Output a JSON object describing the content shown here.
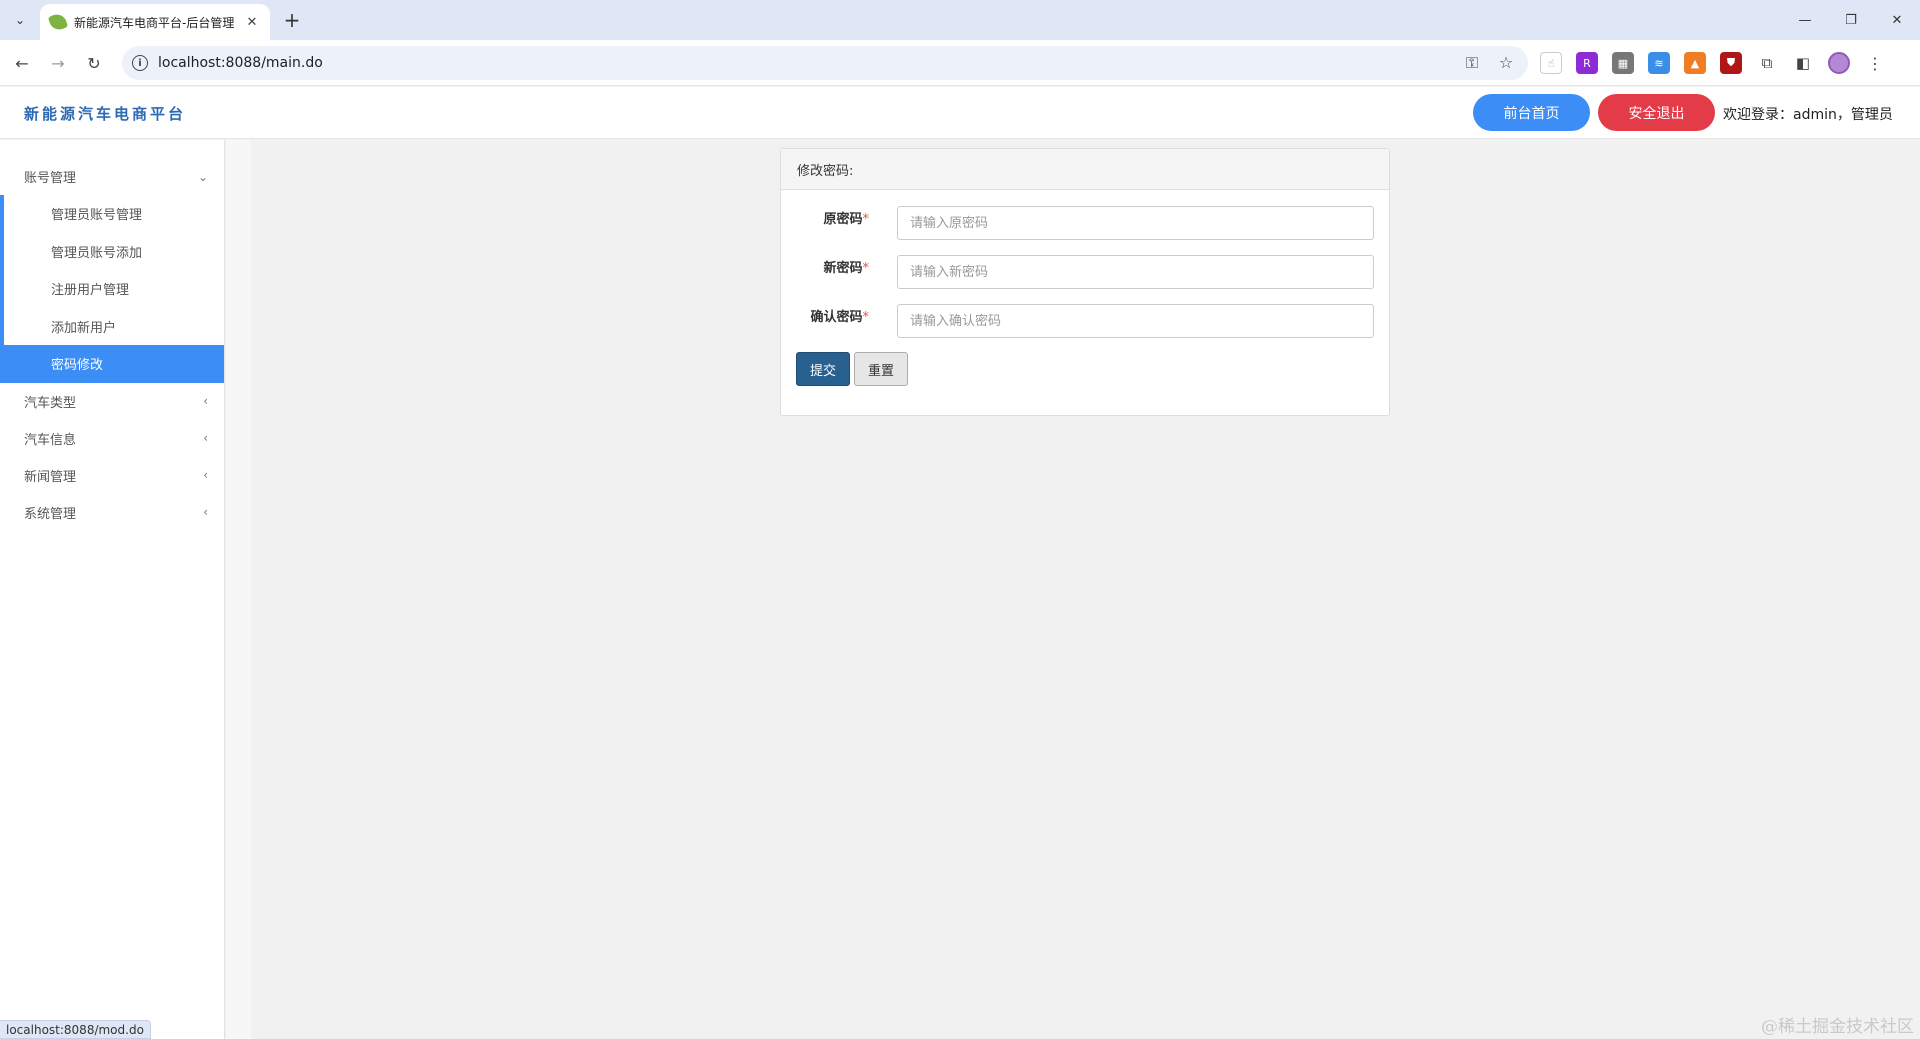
{
  "browser": {
    "tab_title": "新能源汽车电商平台-后台管理",
    "url": "localhost:8088/main.do",
    "status_url": "localhost:8088/mod.do"
  },
  "header": {
    "brand": "新能源汽车电商平台",
    "home_button": "前台首页",
    "logout_button": "安全退出",
    "welcome": "欢迎登录：admin，管理员"
  },
  "sidebar": {
    "groups": [
      {
        "label": "账号管理",
        "expanded": true
      },
      {
        "label": "汽车类型",
        "expanded": false
      },
      {
        "label": "汽车信息",
        "expanded": false
      },
      {
        "label": "新闻管理",
        "expanded": false
      },
      {
        "label": "系统管理",
        "expanded": false
      }
    ],
    "sub_items": [
      "管理员账号管理",
      "管理员账号添加",
      "注册用户管理",
      "添加新用户",
      "密码修改"
    ],
    "active_sub_item": "密码修改"
  },
  "panel": {
    "title": "修改密码:",
    "fields": [
      {
        "label": "原密码",
        "required": "*",
        "placeholder": "请输入原密码",
        "value": ""
      },
      {
        "label": "新密码",
        "required": "*",
        "placeholder": "请输入新密码",
        "value": ""
      },
      {
        "label": "确认密码",
        "required": "*",
        "placeholder": "请输入确认密码",
        "value": ""
      }
    ],
    "submit_label": "提交",
    "reset_label": "重置"
  },
  "watermark": "@稀土掘金技术社区",
  "colors": {
    "primary": "#3d8df6",
    "danger": "#e43b48",
    "brand_text": "#2d6ab4",
    "submit": "#286090"
  },
  "icons": [
    "tab-list-icon",
    "leaf-favicon-icon",
    "close-icon",
    "plus-icon",
    "back-icon",
    "forward-icon",
    "reload-icon",
    "info-icon",
    "key-icon",
    "star-icon",
    "chevron-down-icon",
    "chevron-left-icon"
  ]
}
